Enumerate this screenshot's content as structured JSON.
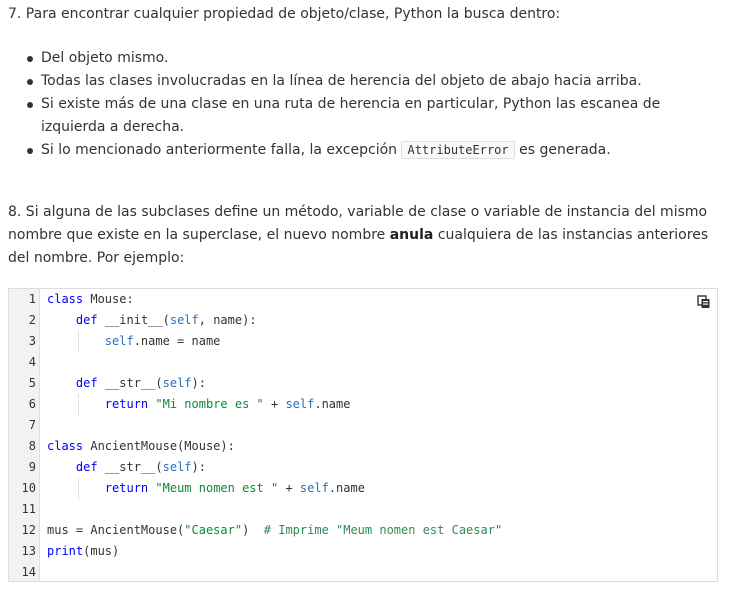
{
  "paragraph7": {
    "text": "7. Para encontrar cualquier propiedad de objeto/clase, Python la busca dentro:"
  },
  "bullets": {
    "b1": "Del objeto mismo.",
    "b2": "Todas las clases involucradas en la línea de herencia del objeto de abajo hacia arriba.",
    "b3": "Si existe más de una clase en una ruta de herencia en particular, Python las escanea de izquierda a derecha.",
    "b4_before": "Si lo mencionado anteriormente falla, la excepción",
    "b4_code": "AttributeError",
    "b4_after": "es generada."
  },
  "paragraph8": {
    "before": "8. Si alguna de las subclases define un método, variable de clase o variable de instancia del mismo nombre que existe en la superclase, el nuevo nombre",
    "bold": "anula",
    "after": "cualquiera de las instancias anteriores del nombre. Por ejemplo:"
  },
  "code": {
    "line_numbers": [
      "1",
      "2",
      "3",
      "4",
      "5",
      "6",
      "7",
      "8",
      "9",
      "10",
      "11",
      "12",
      "13",
      "14"
    ],
    "lines": [
      [
        {
          "t": "class",
          "c": "kw"
        },
        {
          "t": " Mouse:",
          "c": ""
        }
      ],
      [
        {
          "t": "    ",
          "c": ""
        },
        {
          "t": "def",
          "c": "kw"
        },
        {
          "t": " __init__(",
          "c": ""
        },
        {
          "t": "self",
          "c": "slf"
        },
        {
          "t": ", name):",
          "c": ""
        }
      ],
      [
        {
          "t": "        ",
          "c": ""
        },
        {
          "t": "self",
          "c": "slf"
        },
        {
          "t": ".name = name",
          "c": ""
        }
      ],
      [],
      [
        {
          "t": "    ",
          "c": ""
        },
        {
          "t": "def",
          "c": "kw"
        },
        {
          "t": " __str__(",
          "c": ""
        },
        {
          "t": "self",
          "c": "slf"
        },
        {
          "t": "):",
          "c": ""
        }
      ],
      [
        {
          "t": "        ",
          "c": ""
        },
        {
          "t": "return",
          "c": "kw"
        },
        {
          "t": " ",
          "c": ""
        },
        {
          "t": "\"Mi nombre es \"",
          "c": "str"
        },
        {
          "t": " + ",
          "c": ""
        },
        {
          "t": "self",
          "c": "slf"
        },
        {
          "t": ".name",
          "c": ""
        }
      ],
      [],
      [
        {
          "t": "class",
          "c": "kw"
        },
        {
          "t": " AncientMouse(Mouse):",
          "c": ""
        }
      ],
      [
        {
          "t": "    ",
          "c": ""
        },
        {
          "t": "def",
          "c": "kw"
        },
        {
          "t": " __str__(",
          "c": ""
        },
        {
          "t": "self",
          "c": "slf"
        },
        {
          "t": "):",
          "c": ""
        }
      ],
      [
        {
          "t": "        ",
          "c": ""
        },
        {
          "t": "return",
          "c": "kw"
        },
        {
          "t": " ",
          "c": ""
        },
        {
          "t": "\"Meum nomen est \"",
          "c": "str"
        },
        {
          "t": " + ",
          "c": ""
        },
        {
          "t": "self",
          "c": "slf"
        },
        {
          "t": ".name",
          "c": ""
        }
      ],
      [],
      [
        {
          "t": "mus = AncientMouse(",
          "c": ""
        },
        {
          "t": "\"Caesar\"",
          "c": "str"
        },
        {
          "t": ")  ",
          "c": ""
        },
        {
          "t": "# Imprime \"Meum nomen est Caesar\"",
          "c": "com"
        }
      ],
      [
        {
          "t": "print",
          "c": "kw"
        },
        {
          "t": "(mus)",
          "c": ""
        }
      ],
      []
    ],
    "copy_icon": "copy-icon"
  }
}
